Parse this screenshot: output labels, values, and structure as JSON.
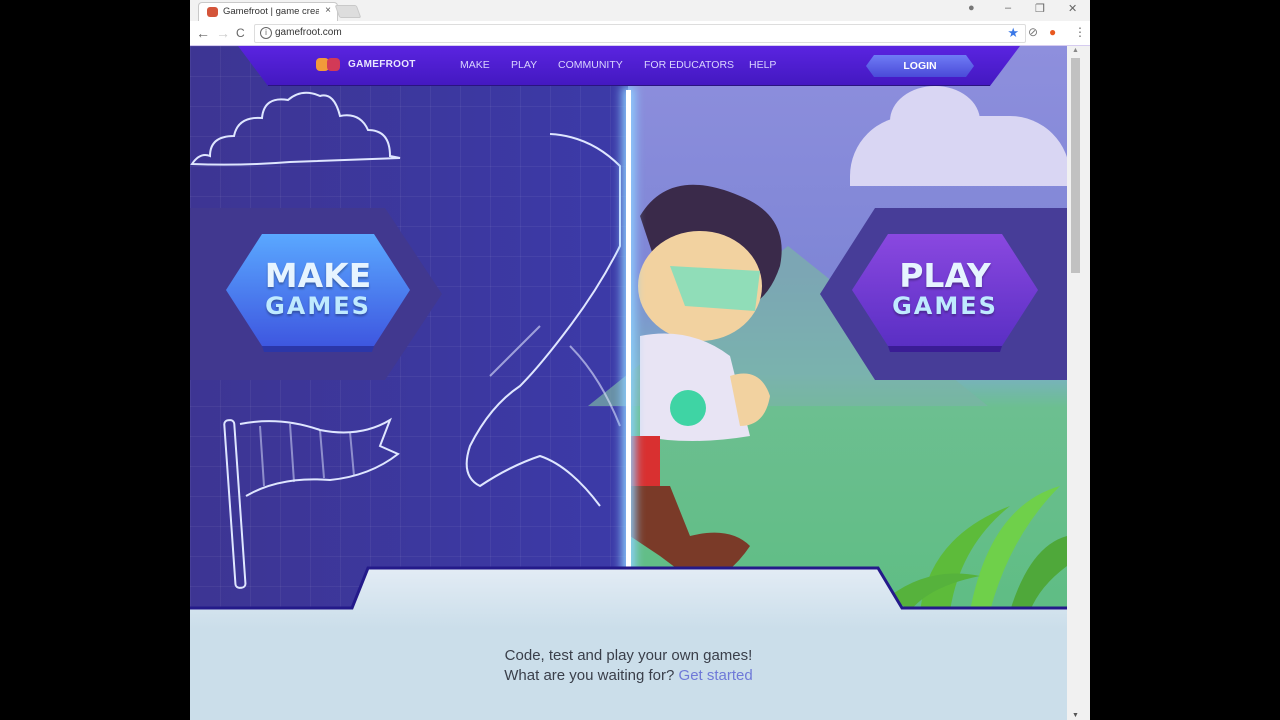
{
  "browser": {
    "tab_title": "Gamefroot | game creat",
    "tab_close": "×",
    "url": "gamefroot.com",
    "nav": {
      "back": "←",
      "forward": "→",
      "reload": "C"
    },
    "window_controls": {
      "profile": "●",
      "minimize": "–",
      "restore": "❐",
      "close": "✕"
    },
    "extensions": {
      "bookmark_star": "★",
      "ext_block": "⊘",
      "ext_orange": "●",
      "menu": "⋮"
    }
  },
  "site": {
    "brand": "GAMEFROOT",
    "menu": [
      "MAKE",
      "PLAY",
      "COMMUNITY",
      "FOR EDUCATORS",
      "HELP"
    ],
    "login": "LOGIN",
    "make_button": {
      "line1": "MAKE",
      "line2": "GAMES"
    },
    "play_button": {
      "line1": "PLAY",
      "line2": "GAMES"
    },
    "tagline_line1": "Code, test and play your own games!",
    "tagline_line2": "What are you waiting for?",
    "get_started": "Get started"
  },
  "colors": {
    "nav_purple": "#4a1fd0",
    "blueprint": "#3c3aa8",
    "make_blue": "#4f7ef0",
    "play_purple": "#7b3fd6",
    "link": "#6f79d8",
    "lower_bg": "#c9dcea"
  },
  "scrollbar": {
    "position_fraction": 0.0
  }
}
